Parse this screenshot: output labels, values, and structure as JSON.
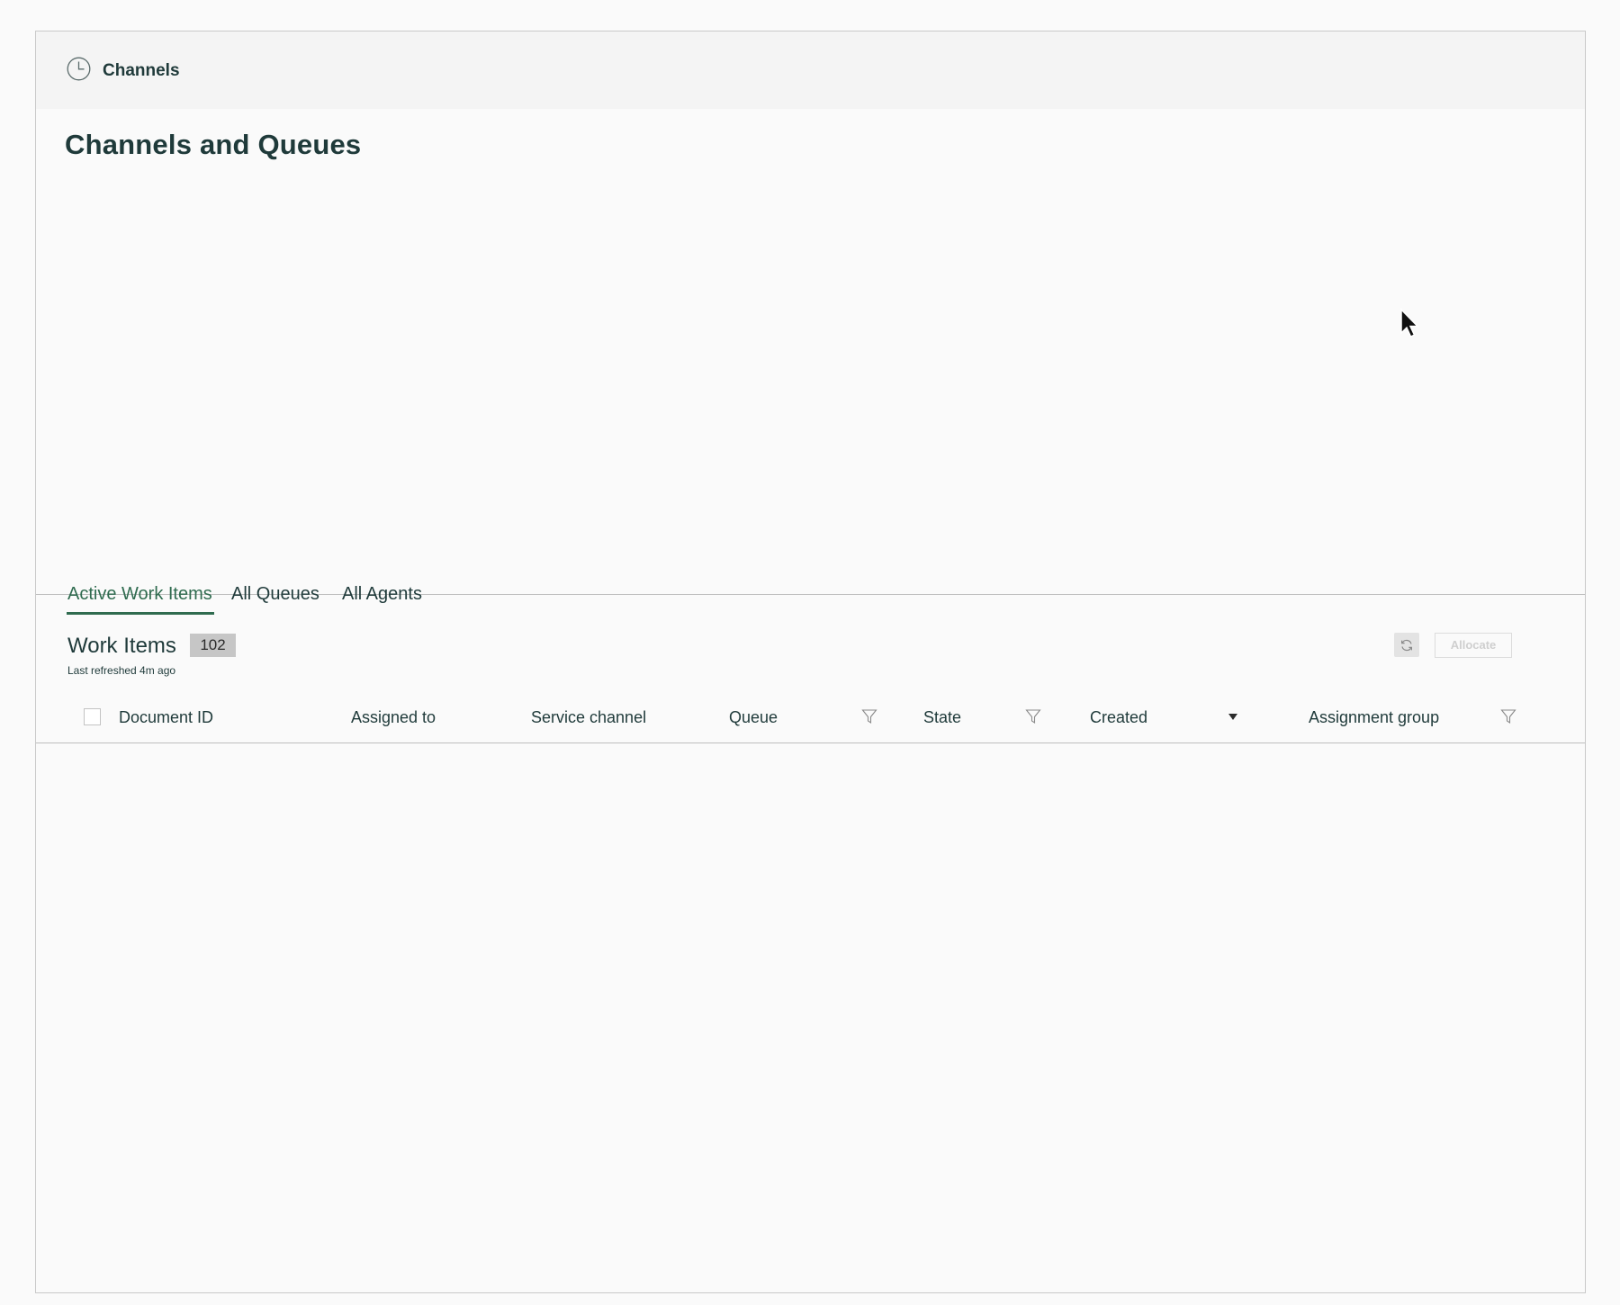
{
  "header": {
    "title": "Channels",
    "icon": "clock-icon"
  },
  "page": {
    "title": "Channels and Queues"
  },
  "tabs": [
    {
      "label": "Active Work Items",
      "active": true
    },
    {
      "label": "All Queues",
      "active": false
    },
    {
      "label": "All Agents",
      "active": false
    }
  ],
  "work_items": {
    "title": "Work Items",
    "count": "102",
    "last_refreshed": "Last refreshed 4m ago",
    "allocate_label": "Allocate",
    "refresh_icon": "refresh-icon"
  },
  "table": {
    "columns": [
      {
        "label": "Document ID"
      },
      {
        "label": "Assigned to"
      },
      {
        "label": "Service channel"
      },
      {
        "label": "Queue",
        "filter": true
      },
      {
        "label": "State",
        "filter": true
      },
      {
        "label": "Created",
        "sorted": "descending"
      },
      {
        "label": "Assignment group",
        "filter": true
      }
    ],
    "rows": []
  },
  "colors": {
    "accent": "#2f6b4f",
    "text": "#1f3a3a",
    "header_bg": "#f4f4f4",
    "badge_bg": "#c6c6c6"
  }
}
